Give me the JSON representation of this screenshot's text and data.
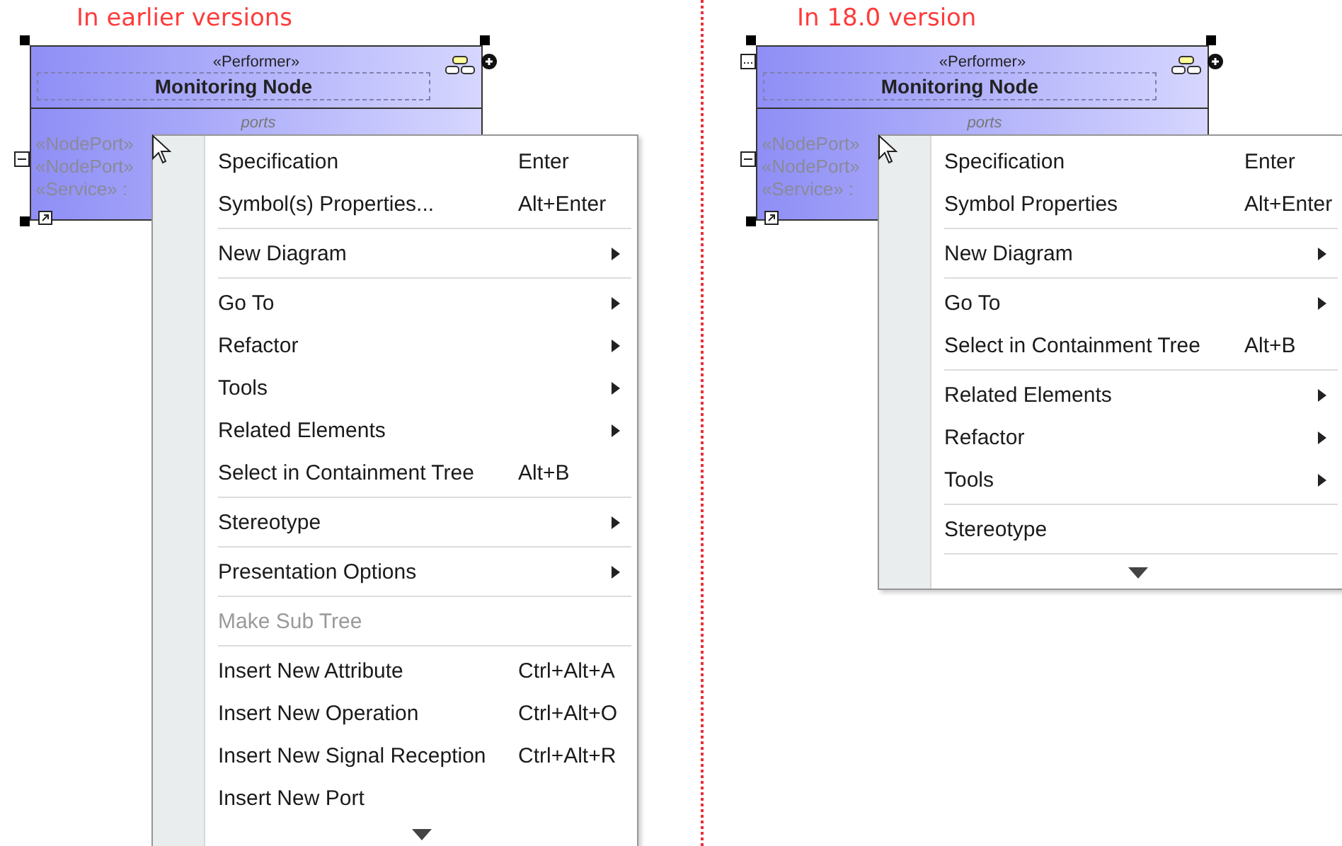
{
  "panels": [
    {
      "caption": "In earlier versions",
      "node": {
        "stereotype": "«Performer»",
        "name": "Monitoring Node",
        "compartment": "ports",
        "ports": [
          "«NodePort»",
          "«NodePort»",
          "«Service» :"
        ],
        "more_handle": false
      },
      "menu": {
        "items": [
          {
            "kind": "item",
            "label": "Specification",
            "shortcut": "Enter",
            "submenu": false,
            "disabled": false
          },
          {
            "kind": "item",
            "label": "Symbol(s) Properties...",
            "shortcut": "Alt+Enter",
            "submenu": false,
            "disabled": false
          },
          {
            "kind": "separator"
          },
          {
            "kind": "item",
            "label": "New Diagram",
            "submenu": true,
            "disabled": false
          },
          {
            "kind": "separator"
          },
          {
            "kind": "item",
            "label": "Go To",
            "submenu": true,
            "disabled": false
          },
          {
            "kind": "item",
            "label": "Refactor",
            "submenu": true,
            "disabled": false
          },
          {
            "kind": "item",
            "label": "Tools",
            "submenu": true,
            "disabled": false
          },
          {
            "kind": "item",
            "label": "Related Elements",
            "submenu": true,
            "disabled": false
          },
          {
            "kind": "item",
            "label": "Select in Containment Tree",
            "shortcut": "Alt+B",
            "submenu": false,
            "disabled": false
          },
          {
            "kind": "separator"
          },
          {
            "kind": "item",
            "label": "Stereotype",
            "submenu": true,
            "disabled": false
          },
          {
            "kind": "separator"
          },
          {
            "kind": "item",
            "label": "Presentation Options",
            "submenu": true,
            "disabled": false
          },
          {
            "kind": "separator"
          },
          {
            "kind": "item",
            "label": "Make Sub Tree",
            "submenu": false,
            "disabled": true
          },
          {
            "kind": "separator"
          },
          {
            "kind": "item",
            "label": "Insert New Attribute",
            "shortcut": "Ctrl+Alt+A",
            "submenu": false,
            "disabled": false
          },
          {
            "kind": "item",
            "label": "Insert New Operation",
            "shortcut": "Ctrl+Alt+O",
            "submenu": false,
            "disabled": false
          },
          {
            "kind": "item",
            "label": "Insert New Signal Reception",
            "shortcut": "Ctrl+Alt+R",
            "submenu": false,
            "disabled": false
          },
          {
            "kind": "item",
            "label": "Insert New Port",
            "submenu": false,
            "disabled": false
          },
          {
            "kind": "more"
          }
        ]
      }
    },
    {
      "caption": "In 18.0 version",
      "node": {
        "stereotype": "«Performer»",
        "name": "Monitoring Node",
        "compartment": "ports",
        "ports": [
          "«NodePort»",
          "«NodePort»",
          "«Service» :"
        ],
        "more_handle": true
      },
      "menu": {
        "items": [
          {
            "kind": "item",
            "label": "Specification",
            "shortcut": "Enter",
            "submenu": false,
            "disabled": false
          },
          {
            "kind": "item",
            "label": "Symbol Properties",
            "shortcut": "Alt+Enter",
            "submenu": false,
            "disabled": false
          },
          {
            "kind": "separator"
          },
          {
            "kind": "item",
            "label": "New Diagram",
            "submenu": true,
            "disabled": false
          },
          {
            "kind": "separator"
          },
          {
            "kind": "item",
            "label": "Go To",
            "submenu": true,
            "disabled": false
          },
          {
            "kind": "item",
            "label": "Select in Containment Tree",
            "shortcut": "Alt+B",
            "submenu": false,
            "disabled": false
          },
          {
            "kind": "separator"
          },
          {
            "kind": "item",
            "label": "Related Elements",
            "submenu": true,
            "disabled": false
          },
          {
            "kind": "item",
            "label": "Refactor",
            "submenu": true,
            "disabled": false
          },
          {
            "kind": "item",
            "label": "Tools",
            "submenu": true,
            "disabled": false
          },
          {
            "kind": "separator"
          },
          {
            "kind": "item",
            "label": "Stereotype",
            "submenu": false,
            "disabled": false
          },
          {
            "kind": "separator"
          },
          {
            "kind": "more"
          }
        ]
      }
    }
  ]
}
